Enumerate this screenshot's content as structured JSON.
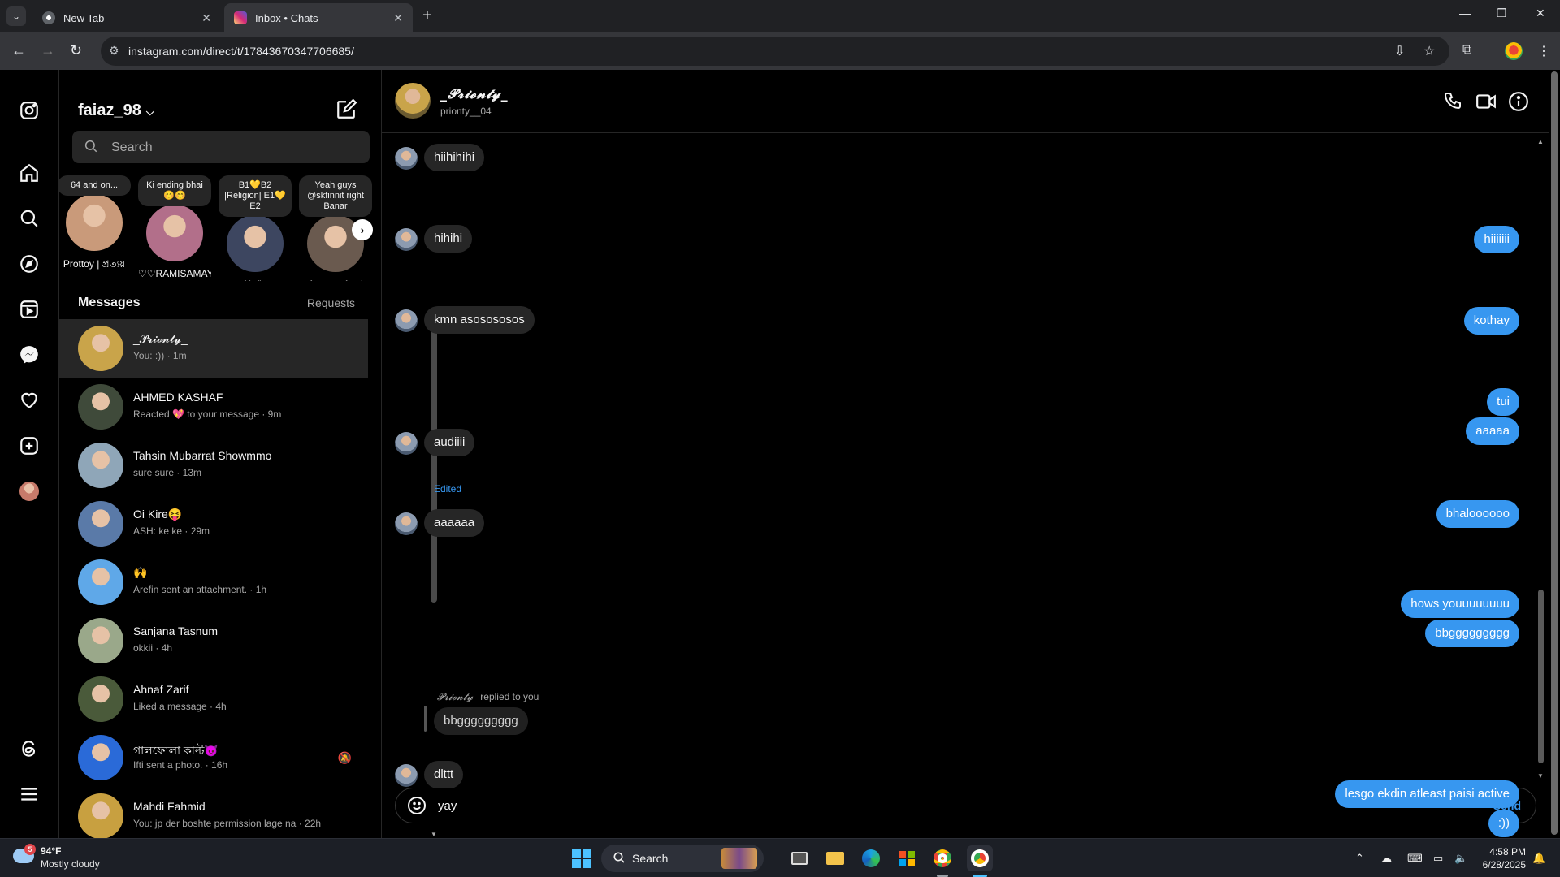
{
  "browser": {
    "tabs": [
      {
        "title": "New Tab",
        "active": false
      },
      {
        "title": "Inbox • Chats",
        "active": true
      }
    ],
    "url": "instagram.com/direct/t/17843670347706685/"
  },
  "sidebar": {
    "icons": [
      "instagram-icon",
      "home-icon",
      "search-icon",
      "explore-icon",
      "reels-icon",
      "messenger-icon",
      "heart-icon",
      "create-icon",
      "profile-avatar",
      "threads-icon",
      "menu-icon"
    ]
  },
  "inbox": {
    "username": "faiaz_98",
    "search_placeholder": "Search",
    "notes": [
      {
        "note": "64 and on...",
        "name": "Prottoy | প্রত্যয়",
        "color": "#c99a7a"
      },
      {
        "note": "Ki ending bhai 😊😊",
        "name": "♡♡RAMISAMAY...",
        "color": "#b26f8a"
      },
      {
        "note": "B1💛B2 |Religion| E1💛E2",
        "name": "Nafis",
        "color": "#3d4660"
      },
      {
        "note": "Yeah guys @skfinnit right Banar",
        "name": "Ananyo Anul",
        "color": "#6a5a4f"
      }
    ],
    "messages_label": "Messages",
    "requests_label": "Requests",
    "conversations": [
      {
        "name": "_𝓟𝓻𝓲𝓸𝓷𝓽𝔂_",
        "preview": "You: :)) · 1m",
        "active": true,
        "color": "#c9a44a"
      },
      {
        "name": "AHMED KASHAF",
        "preview": "Reacted 💖 to your message · 9m",
        "active": false,
        "color": "#3f4a3a"
      },
      {
        "name": "Tahsin Mubarrat Showmmo",
        "preview": "sure sure · 13m",
        "active": false,
        "color": "#8fa6b8"
      },
      {
        "name": "Oi Kire😝",
        "preview": "ASH: ke ke · 29m",
        "active": false,
        "color": "#5a7aa8"
      },
      {
        "name": "🙌",
        "preview": "Arefin sent an attachment. · 1h",
        "active": false,
        "color": "#5fa8e8"
      },
      {
        "name": "Sanjana Tasnum",
        "preview": "okkii · 4h",
        "active": false,
        "color": "#9aa88a"
      },
      {
        "name": "Ahnaf Zarif",
        "preview": "Liked a message · 4h",
        "active": false,
        "color": "#4a5a3a"
      },
      {
        "name": "গালফোলা কাল্ট👿",
        "preview": "Ifti sent a photo. · 16h",
        "active": false,
        "color": "#2a6ad8",
        "muted": true
      },
      {
        "name": "Mahdi Fahmid",
        "preview": "You: jp der boshte permission lage na · 22h",
        "active": false,
        "color": "#c8a040"
      }
    ]
  },
  "chat": {
    "display_name": "_𝓟𝓻𝓲𝓸𝓷𝓽𝔂_",
    "handle": "prionty__04",
    "edited_label": "Edited",
    "reply_who": "_𝓟𝓻𝓲𝓸𝓷𝓽𝔂_",
    "reply_text": " replied to you",
    "quoted": "bbggggggggg",
    "messages": [
      {
        "dir": "in",
        "text": "hiihihihi"
      },
      {
        "dir": "out",
        "text": "hiiiiiii"
      },
      {
        "dir": "in",
        "text": "hihihi"
      },
      {
        "dir": "out",
        "text": "kothay"
      },
      {
        "dir": "in",
        "text": "kmn asosososos"
      },
      {
        "dir": "out",
        "text": "tui"
      },
      {
        "dir": "out",
        "text": "aaaaa"
      },
      {
        "dir": "in",
        "text": "audiiii"
      },
      {
        "dir": "out",
        "text": "bhaloooooo"
      },
      {
        "dir": "in",
        "text": "aaaaaa"
      },
      {
        "dir": "out",
        "text": "hows youuuuuuuu"
      },
      {
        "dir": "out",
        "text": "bbggggggggg"
      },
      {
        "dir": "in",
        "text": "dlttt"
      },
      {
        "dir": "out",
        "text": "lesgo ekdin atleast paisi active"
      },
      {
        "dir": "out",
        "text": ":))"
      }
    ],
    "composer_text": "yay",
    "send_label": "Send"
  },
  "taskbar": {
    "weather_temp": "94°F",
    "weather_cond": "Mostly cloudy",
    "weather_badge": "5",
    "search_label": "Search",
    "time": "4:58 PM",
    "date": "6/28/2025"
  },
  "colors": {
    "accent": "#3797f0",
    "bubble_in": "#262626",
    "bg": "#000000"
  }
}
